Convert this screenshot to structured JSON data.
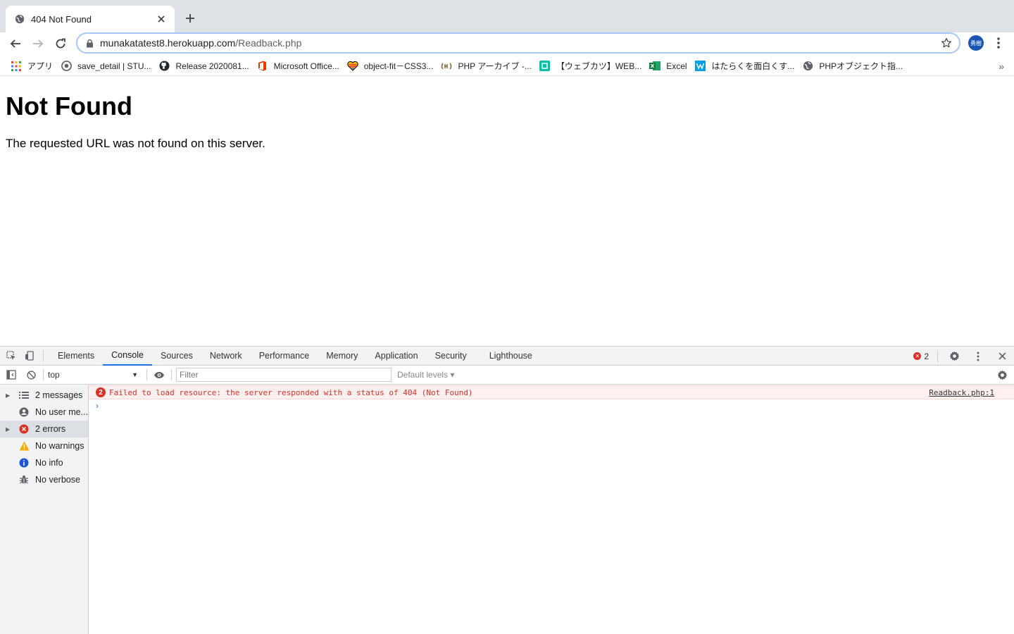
{
  "tab": {
    "title": "404 Not Found"
  },
  "toolbar": {
    "url_host": "munakatatest8.herokuapp.com",
    "url_path": "/Readback.php",
    "avatar_text": "勇樹"
  },
  "bookmarks": [
    {
      "label": "アプリ",
      "icon": "apps-grid-icon",
      "color": "#ea4335"
    },
    {
      "label": "save_detail | STU...",
      "icon": "gear-globe-icon",
      "color": "#5f6368"
    },
    {
      "label": "Release 2020081...",
      "icon": "github-icon",
      "color": "#24292e"
    },
    {
      "label": "Microsoft Office...",
      "icon": "office-icon",
      "color": "#eb3c00"
    },
    {
      "label": "object-fit－CSS3...",
      "icon": "heart-icon",
      "color": "#f4b400"
    },
    {
      "label": "PHP アーカイブ -...",
      "icon": "php-logo-icon",
      "color": "#8a6d3b"
    },
    {
      "label": "【ウェブカツ】WEB...",
      "icon": "webukatu-icon",
      "color": "#00c2a8"
    },
    {
      "label": "Excel",
      "icon": "excel-icon",
      "color": "#1d6f42"
    },
    {
      "label": "はたらくを面白くす...",
      "icon": "w-logo-icon",
      "color": "#00a0e9"
    },
    {
      "label": "PHPオブジェクト指...",
      "icon": "globe-icon",
      "color": "#5f6368"
    }
  ],
  "page": {
    "heading": "Not Found",
    "message": "The requested URL was not found on this server."
  },
  "devtools": {
    "tabs": [
      "Elements",
      "Console",
      "Sources",
      "Network",
      "Performance",
      "Memory",
      "Application",
      "Security",
      "Lighthouse"
    ],
    "active_tab": "Console",
    "error_count": "2",
    "context": "top",
    "filter_placeholder": "Filter",
    "levels_label": "Default levels ▾",
    "sidebar": [
      {
        "label": "2 messages",
        "icon": "list-icon",
        "expandable": true
      },
      {
        "label": "No user me...",
        "icon": "user-icon",
        "expandable": false
      },
      {
        "label": "2 errors",
        "icon": "error-icon",
        "expandable": true,
        "selected": true
      },
      {
        "label": "No warnings",
        "icon": "warning-icon",
        "expandable": false
      },
      {
        "label": "No info",
        "icon": "info-icon",
        "expandable": false
      },
      {
        "label": "No verbose",
        "icon": "bug-icon",
        "expandable": false
      }
    ],
    "message": {
      "badge": "2",
      "text": "Failed to load resource: the server responded with a status of 404 (Not Found)",
      "source": "Readback.php:1"
    }
  },
  "colors": {
    "error": "#d93025",
    "accent": "#1a73e8",
    "tabstrip": "#dee1e6"
  }
}
